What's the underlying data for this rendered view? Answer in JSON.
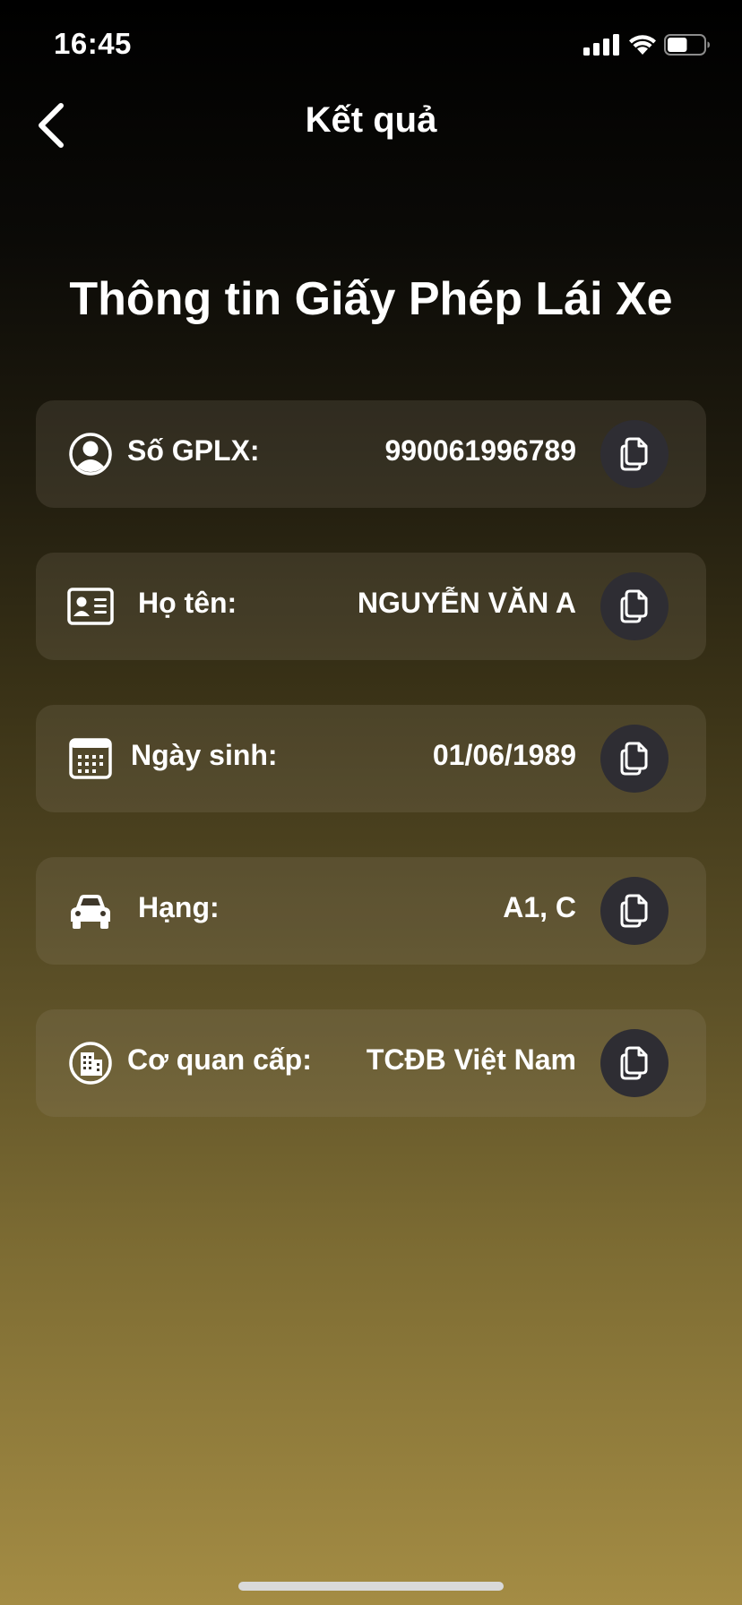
{
  "status_bar": {
    "time": "16:45",
    "battery_level": 0.55
  },
  "nav": {
    "back_icon": "chevron-left-icon",
    "title": "Kết quả"
  },
  "page": {
    "title": "Thông tin Giấy Phép Lái Xe"
  },
  "rows": [
    {
      "icon": "user-circle-icon",
      "label": "Số GPLX:",
      "value": "990061996789",
      "copy_icon": "copy-icon"
    },
    {
      "icon": "id-card-icon",
      "label": "Họ tên:",
      "value": "NGUYỄN VĂN A",
      "copy_icon": "copy-icon"
    },
    {
      "icon": "calendar-icon",
      "label": "Ngày sinh:",
      "value": "01/06/1989",
      "copy_icon": "copy-icon"
    },
    {
      "icon": "car-icon",
      "label": "Hạng:",
      "value": "A1, C",
      "copy_icon": "copy-icon"
    },
    {
      "icon": "building-icon",
      "label": "Cơ quan cấp:",
      "value": "TCĐB Việt Nam",
      "copy_icon": "copy-icon"
    }
  ],
  "colors": {
    "background_top": "#000000",
    "background_bottom": "#a48c44",
    "card": "#4a4332",
    "copy_button": "#2e2d33",
    "text": "#ffffff"
  }
}
